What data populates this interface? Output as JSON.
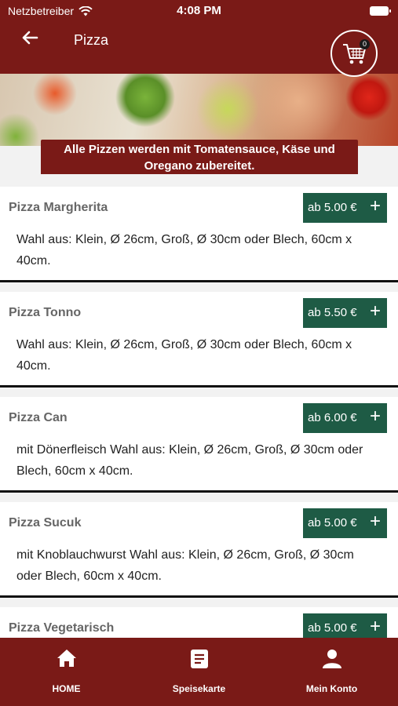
{
  "status_bar": {
    "carrier": "Netzbetreiber",
    "time": "4:08 PM"
  },
  "header": {
    "title": "Pizza",
    "cart_count": "0"
  },
  "notice": "Alle Pizzen werden mit Tomatensauce, Käse und Oregano zubereitet.",
  "pizzas": [
    {
      "name": "Pizza Margherita",
      "price": "ab 5.00 €",
      "description": "Wahl aus: Klein, Ø 26cm, Groß, Ø 30cm oder Blech, 60cm x 40cm."
    },
    {
      "name": "Pizza Tonno",
      "price": "ab 5.50 €",
      "description": "Wahl aus: Klein, Ø 26cm, Groß, Ø 30cm oder Blech, 60cm x 40cm."
    },
    {
      "name": "Pizza Can",
      "price": "ab 6.00 €",
      "description": "mit Dönerfleisch Wahl aus: Klein, Ø 26cm, Groß, Ø 30cm oder Blech, 60cm x 40cm."
    },
    {
      "name": "Pizza Sucuk",
      "price": "ab 5.00 €",
      "description": "mit Knoblauchwurst Wahl aus: Klein, Ø 26cm, Groß, Ø 30cm oder Blech, 60cm x 40cm."
    },
    {
      "name": "Pizza Vegetarisch",
      "price": "ab 5.00 €",
      "description": ""
    }
  ],
  "tabbar": {
    "home": "HOME",
    "menu": "Speisekarte",
    "account": "Mein Konto"
  },
  "colors": {
    "primary": "#7a1a17",
    "accent": "#1e5b45"
  }
}
